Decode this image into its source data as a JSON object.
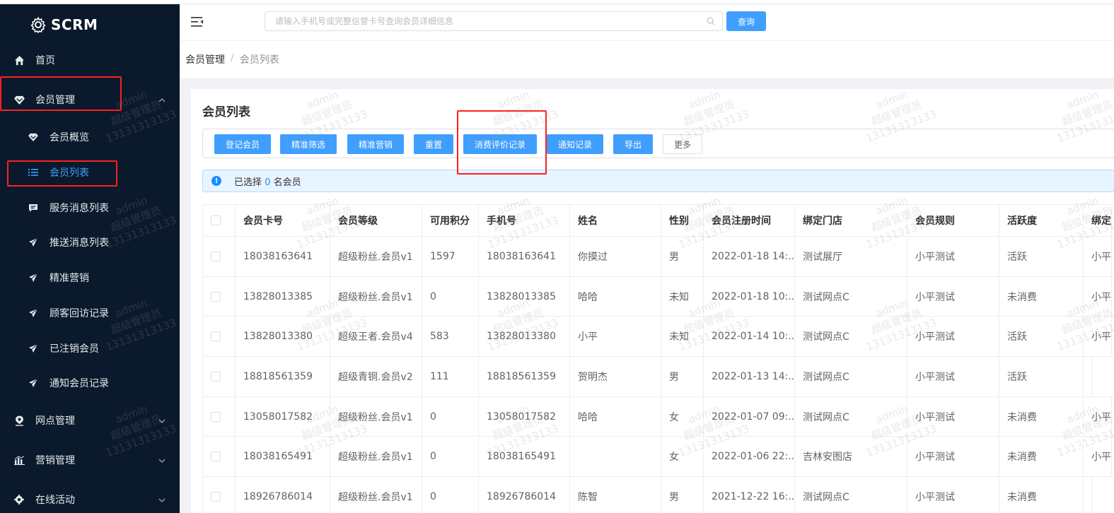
{
  "app": {
    "logo_text": "SCRM"
  },
  "sidebar": {
    "items": [
      {
        "label": "首页",
        "icon": "home-icon"
      },
      {
        "label": "会员管理",
        "icon": "diamond-icon",
        "expanded": true
      },
      {
        "label": "会员概览",
        "icon": "diamond-icon"
      },
      {
        "label": "会员列表",
        "icon": "list-icon",
        "active": true
      },
      {
        "label": "服务消息列表",
        "icon": "message-icon"
      },
      {
        "label": "推送消息列表",
        "icon": "send-icon"
      },
      {
        "label": "精准营销",
        "icon": "send-icon"
      },
      {
        "label": "顾客回访记录",
        "icon": "send-icon"
      },
      {
        "label": "已注销会员",
        "icon": "send-icon"
      },
      {
        "label": "通知会员记录",
        "icon": "send-icon"
      },
      {
        "label": "网点管理",
        "icon": "location-icon"
      },
      {
        "label": "营销管理",
        "icon": "chart-icon"
      },
      {
        "label": "在线活动",
        "icon": "gear-icon"
      }
    ]
  },
  "header": {
    "search_placeholder": "请输入手机号或完整信誉卡号查询会员详细信息",
    "query_label": "查询"
  },
  "breadcrumb": {
    "parent": "会员管理",
    "separator": "/",
    "current": "会员列表"
  },
  "main": {
    "title": "会员列表",
    "buttons": [
      "登记会员",
      "精准筛选",
      "精准营销",
      "重置",
      "消费评价记录",
      "通知记录",
      "导出",
      "更多"
    ],
    "alert": {
      "prefix": "已选择",
      "count": "0",
      "suffix": "名会员"
    }
  },
  "table": {
    "columns": [
      "会员卡号",
      "会员等级",
      "可用积分",
      "手机号",
      "姓名",
      "性别",
      "会员注册时间",
      "绑定门店",
      "会员规则",
      "活跃度",
      "绑定"
    ],
    "rows": [
      [
        "18038163641",
        "超级粉丝.会员v1",
        "1597",
        "18038163641",
        "你摸过",
        "男",
        "2022-01-18 14:...",
        "测试展厅",
        "小平测试",
        "活跃",
        "小平"
      ],
      [
        "13828013385",
        "超级粉丝.会员v1",
        "0",
        "13828013385",
        "哈哈",
        "未知",
        "2022-01-18 10:...",
        "测试网点C",
        "小平测试",
        "未消费",
        "小平"
      ],
      [
        "13828013380",
        "超级王者.会员v4",
        "583",
        "13828013380",
        "小平",
        "未知",
        "2022-01-14 10:...",
        "测试网点C",
        "小平测试",
        "活跃",
        "小平"
      ],
      [
        "18818561359",
        "超级青铜.会员v2",
        "111",
        "18818561359",
        "贺明杰",
        "男",
        "2022-01-13 14:...",
        "测试网点C",
        "小平测试",
        "活跃",
        ""
      ],
      [
        "13058017582",
        "超级粉丝.会员v1",
        "0",
        "13058017582",
        "哈哈",
        "女",
        "2022-01-07 09:...",
        "测试网点C",
        "小平测试",
        "未消费",
        "小平"
      ],
      [
        "18038165491",
        "超级粉丝.会员v1",
        "0",
        "18038165491",
        "",
        "女",
        "2022-01-06 22:...",
        "吉林安图店",
        "小平测试",
        "未消费",
        "小平"
      ],
      [
        "18926786014",
        "超级粉丝.会员v1",
        "0",
        "18926786014",
        "陈智",
        "男",
        "2021-12-22 16:...",
        "测试网点C",
        "小平测试",
        "未消费",
        ""
      ]
    ]
  },
  "watermark": {
    "line1": "admin",
    "line2": "超级管理员",
    "line3": "13131313133"
  },
  "colors": {
    "primary": "#409eff",
    "sidebar_bg": "#0a1a2c",
    "highlight_box": "#ff1f1f"
  }
}
